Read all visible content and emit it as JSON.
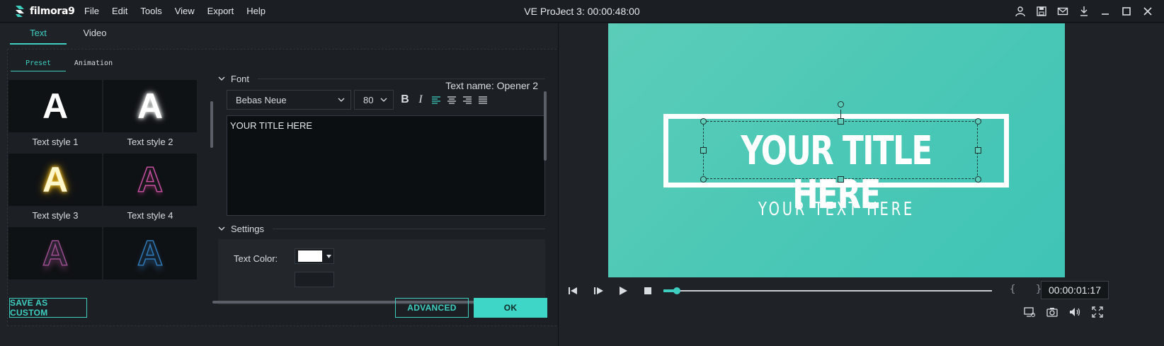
{
  "app": {
    "logo_text": "filmora9",
    "menu": [
      "File",
      "Edit",
      "Tools",
      "View",
      "Export",
      "Help"
    ],
    "window_title": "VE ProJect 3: 00:00:48:00"
  },
  "editor": {
    "main_tabs": [
      "Text",
      "Video"
    ],
    "sub_tabs": [
      "Preset",
      "Animation"
    ],
    "text_name": "Text name: Opener 2",
    "presets": [
      {
        "label": "Text style 1",
        "glyph": "A"
      },
      {
        "label": "Text style 2",
        "glyph": "A"
      },
      {
        "label": "Text style 3",
        "glyph": "A"
      },
      {
        "label": "Text style 4",
        "glyph": "A"
      },
      {
        "label": "",
        "glyph": "A"
      },
      {
        "label": "",
        "glyph": "A"
      }
    ],
    "font_section": "Font",
    "font_family": "Bebas Neue",
    "font_size": "80",
    "bold_glyph": "B",
    "italic_glyph": "I",
    "text_value": "YOUR TITLE HERE",
    "settings_section": "Settings",
    "text_color_label": "Text Color:",
    "text_color": "#ffffff",
    "save_custom_label": "SAVE AS CUSTOM",
    "advanced_label": "ADVANCED",
    "ok_label": "OK"
  },
  "preview": {
    "title": "YOUR TITLE HERE",
    "subtitle": "YOUR TEXT HERE",
    "braces": "{ }",
    "timecode": "00:00:01:17",
    "progress": 0.04
  },
  "colors": {
    "accent": "#3ecfc0",
    "canvas": "#4cc8b6"
  },
  "icons": {
    "window": [
      "user-icon",
      "save-icon",
      "mail-icon",
      "download-icon",
      "minimize-icon",
      "maximize-icon",
      "close-icon"
    ],
    "playback": [
      "step-back-icon",
      "play-frame-icon",
      "play-icon",
      "stop-icon"
    ],
    "bottom": [
      "render-icon",
      "camera-icon",
      "volume-icon",
      "fullscreen-icon"
    ]
  }
}
